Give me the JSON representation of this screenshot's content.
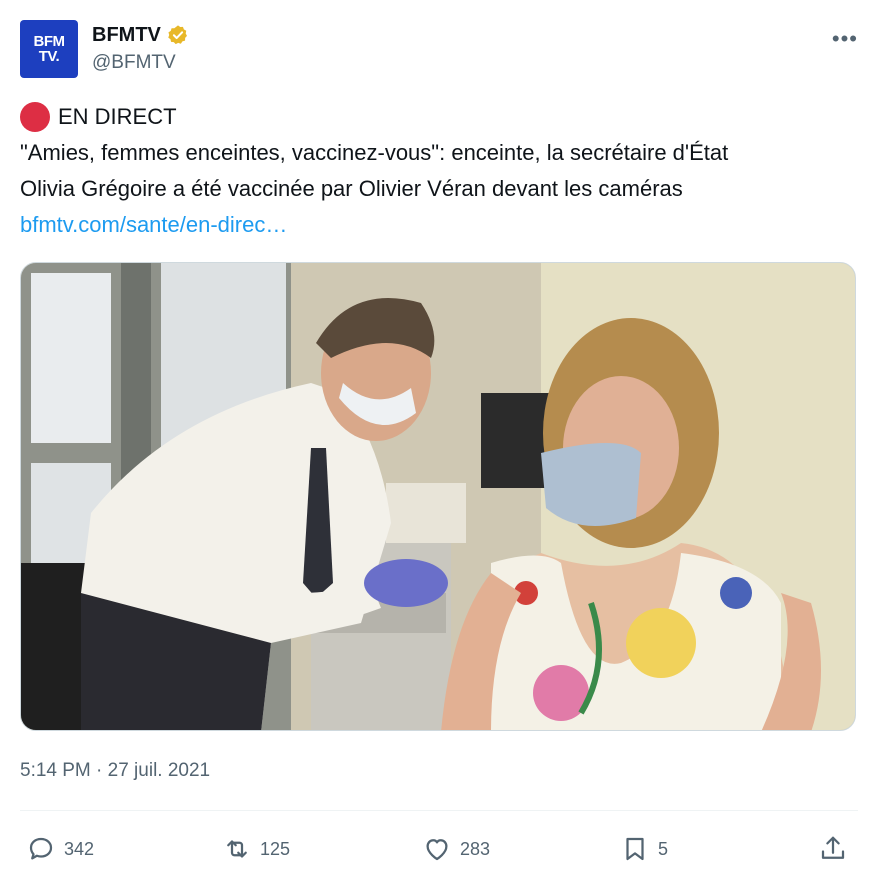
{
  "account": {
    "avatar_line1": "BFM",
    "avatar_line2": "TV.",
    "display_name": "BFMTV",
    "handle": "@BFMTV",
    "verified_color": "#e8b829"
  },
  "tweet": {
    "live_label": "EN DIRECT",
    "line1": "\"Amies, femmes enceintes, vaccinez-vous\": enceinte, la secrétaire d'État",
    "line2": "Olivia Grégoire a été vaccinée par Olivier Véran devant les caméras",
    "link": "bfmtv.com/sante/en-direc…"
  },
  "meta": {
    "timestamp": "5:14 PM · 27 juil. 2021"
  },
  "actions": {
    "replies": "342",
    "retweets": "125",
    "likes": "283",
    "bookmarks": "5"
  },
  "colors": {
    "link": "#1d9bf0",
    "secondary_text": "#536471",
    "live_dot": "#dd2e44",
    "avatar_bg": "#1d3fbf"
  }
}
